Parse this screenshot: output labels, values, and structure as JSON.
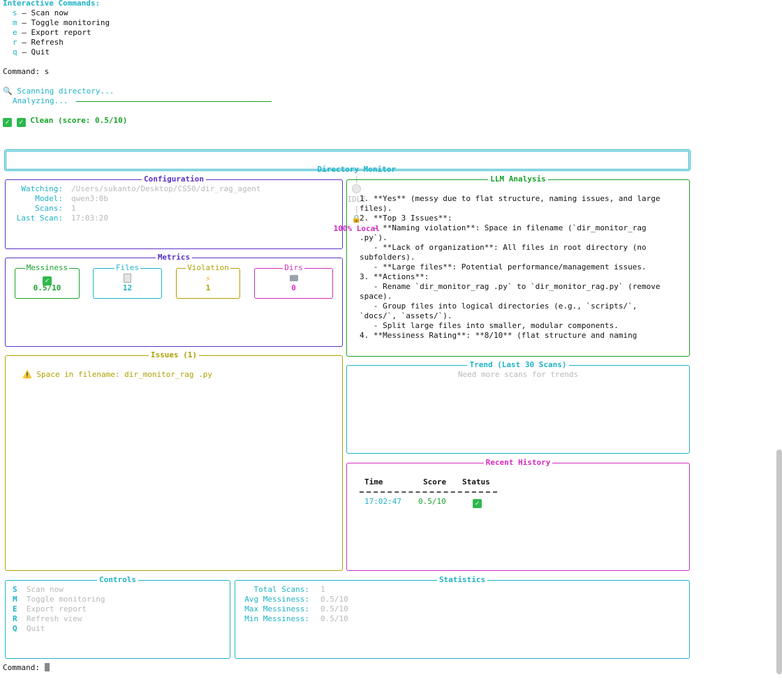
{
  "top": {
    "heading": "Interactive Commands:",
    "commands": [
      {
        "key": "s",
        "label": "– Scan now"
      },
      {
        "key": "m",
        "label": "– Toggle monitoring"
      },
      {
        "key": "e",
        "label": "– Export report"
      },
      {
        "key": "r",
        "label": "– Refresh"
      },
      {
        "key": "q",
        "label": "– Quit"
      }
    ],
    "command_line": "Command: s",
    "scanning": "Scanning directory...",
    "analyzing": "Analyzing...",
    "clean": "Clean (score: 0.5/10)"
  },
  "header": {
    "title": "Directory Monitor",
    "status": "IDLE",
    "local": "100% Local",
    "sep": "|"
  },
  "config": {
    "title": "Configuration",
    "rows": [
      {
        "label": "Watching:",
        "value": "/Users/sukanto/Desktop/CS50/dir_rag_agent"
      },
      {
        "label": "Model:",
        "value": "qwen3:8b"
      },
      {
        "label": "Scans:",
        "value": "1"
      },
      {
        "label": "Last Scan:",
        "value": "17:03:20"
      }
    ]
  },
  "metrics": {
    "title": "Metrics",
    "items": [
      {
        "label": "Messiness",
        "value": "0.5/10",
        "icon": "check-icon"
      },
      {
        "label": "Files",
        "value": "12",
        "icon": "file-icon"
      },
      {
        "label": "Violation",
        "value": "1",
        "icon": "lightning-icon"
      },
      {
        "label": "Dirs",
        "value": "0",
        "icon": "folder-icon"
      }
    ]
  },
  "llm": {
    "title": "LLM Analysis",
    "lines": [
      "1. **Yes** (messy due to flat structure, naming issues, and large",
      "files).",
      "2. **Top 3 Issues**:",
      "   - **Naming violation**: Space in filename (`dir_monitor_rag",
      ".py`).",
      "   - **Lack of organization**: All files in root directory (no",
      "subfolders).",
      "   - **Large files**: Potential performance/management issues.",
      "3. **Actions**:",
      "   - Rename `dir_monitor_rag .py` to `dir_monitor_rag.py` (remove",
      "space).",
      "   - Group files into logical directories (e.g., `scripts/`,",
      "`docs/`, `assets/`).",
      "   - Split large files into smaller, modular components.",
      "4. **Messiness Rating**: **8/10** (flat structure and naming"
    ]
  },
  "issues": {
    "title": "Issues (1)",
    "items": [
      "Space in filename: dir_monitor_rag .py"
    ]
  },
  "trend": {
    "title": "Trend (Last 30 Scans)",
    "message": "Need more scans for trends"
  },
  "history": {
    "title": "Recent History",
    "columns": [
      "Time",
      "Score",
      "Status"
    ],
    "rows": [
      {
        "time": "17:02:47",
        "score": "0.5/10",
        "status": "check-icon"
      }
    ]
  },
  "controls": {
    "title": "Controls",
    "items": [
      {
        "key": "S",
        "label": "Scan now"
      },
      {
        "key": "M",
        "label": "Toggle monitoring"
      },
      {
        "key": "E",
        "label": "Export report"
      },
      {
        "key": "R",
        "label": "Refresh view"
      },
      {
        "key": "Q",
        "label": "Quit"
      }
    ]
  },
  "stats": {
    "title": "Statistics",
    "rows": [
      {
        "label": "Total Scans:",
        "value": "1"
      },
      {
        "label": "Avg Messiness:",
        "value": "0.5/10"
      },
      {
        "label": "Max Messiness:",
        "value": "0.5/10"
      },
      {
        "label": "Min Messiness:",
        "value": "0.5/10"
      }
    ]
  },
  "prompt": {
    "label": "Command:"
  },
  "colors": {
    "cyan": "#1fb3c7",
    "green": "#19a22a",
    "purple": "#5a32c8",
    "olive": "#b0a000",
    "magenta": "#d42cc0"
  }
}
